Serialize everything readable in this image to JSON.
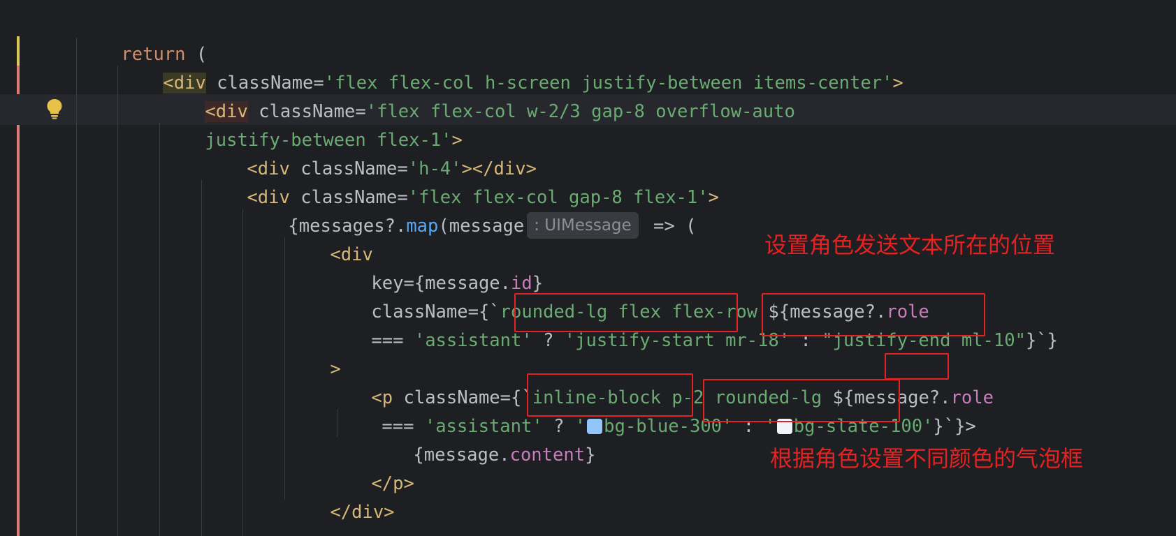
{
  "code": {
    "l1": {
      "kw": "return",
      "rest": " ("
    },
    "l2": {
      "tag_open": "<div",
      "attr": " className=",
      "val": "'flex flex-col h-screen justify-between items-center'",
      "close": ">"
    },
    "l3": {
      "tag_open": "<div",
      "attr": " className=",
      "val": "'flex flex-col w-2/3 gap-8 overflow-auto"
    },
    "l4": {
      "val": "justify-between flex-1'",
      "close": ">"
    },
    "l5": {
      "tag_open": "<div",
      "attr": " className=",
      "val": "'h-4'",
      "close": "></div>"
    },
    "l6": {
      "tag_open": "<div",
      "attr": " className=",
      "val": "'flex flex-col gap-8 flex-1'",
      "close": ">"
    },
    "l7": {
      "pre": "{messages?.",
      "fn": "map",
      "mid": "(message",
      "type_hint": ": UIMessage",
      "post": " => ("
    },
    "l8": {
      "tag_open": "<div"
    },
    "l9": {
      "attr": "key=",
      "pre": "{message.",
      "prop": "id",
      "post": "}"
    },
    "l10": {
      "attr": "className=",
      "pre": "{`",
      "str": "rounded-lg flex flex-row ",
      "interp": "${message?.",
      "prop": "role"
    },
    "l11": {
      "op": "=== ",
      "str1": "'assistant'",
      "q": " ? ",
      "str2": "'justify-start mr-18'",
      "colon": " : ",
      "str3": "\"justify-end ml-10\"",
      "end": "}`}"
    },
    "l12": {
      "close": ">"
    },
    "l13": {
      "tag_open": "<p",
      "attr": " className=",
      "pre": "{`",
      "str": "inline-block p-2 rounded-lg ",
      "interp": "${message?.",
      "prop": "role"
    },
    "l14": {
      "op": "=== ",
      "str1": "'assistant'",
      "q": " ? ",
      "q1": "'",
      "str2": "bg-blue-300'",
      "colon": " : ",
      "q2": "'",
      "str3": "bg-slate-100'",
      "end": "}`}>"
    },
    "l15": {
      "pre": "{message.",
      "prop": "content",
      "post": "}"
    },
    "l16": {
      "tag_close": "</p>"
    },
    "l17": {
      "tag_close": "</div>"
    }
  },
  "colors": {
    "swatch_blue": "#93c5fd",
    "swatch_slate": "#f1f5f9",
    "annotation": "#e52222"
  },
  "annotations": {
    "position_note": "设置角色发送文本所在的位置",
    "bubble_note": "根据角色设置不同颜色的气泡框"
  },
  "icons": {
    "gutter_bulb": "lightbulb-icon"
  }
}
